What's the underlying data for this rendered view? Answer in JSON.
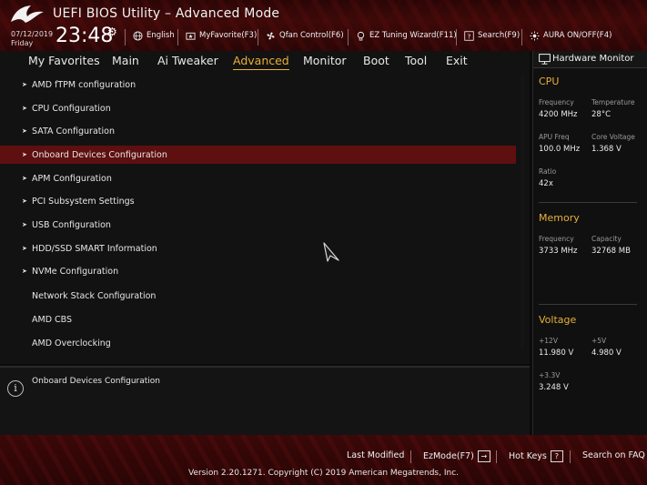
{
  "header": {
    "title": "UEFI BIOS Utility – Advanced Mode",
    "date": "07/12/2019",
    "weekday": "Friday",
    "time": "23:48",
    "buttons": [
      {
        "label": "English",
        "icon": "globe-icon"
      },
      {
        "label": "MyFavorite(F3)",
        "icon": "star-folder-icon"
      },
      {
        "label": "Qfan Control(F6)",
        "icon": "fan-icon"
      },
      {
        "label": "EZ Tuning Wizard(F11)",
        "icon": "lightbulb-icon"
      },
      {
        "label": "Search(F9)",
        "icon": "search-icon"
      },
      {
        "label": "AURA ON/OFF(F4)",
        "icon": "aura-icon"
      }
    ]
  },
  "nav": {
    "tabs": [
      {
        "label": "My Favorites",
        "active": false
      },
      {
        "label": "Main",
        "active": false
      },
      {
        "label": "Ai Tweaker",
        "active": false
      },
      {
        "label": "Advanced",
        "active": true
      },
      {
        "label": "Monitor",
        "active": false
      },
      {
        "label": "Boot",
        "active": false
      },
      {
        "label": "Tool",
        "active": false
      },
      {
        "label": "Exit",
        "active": false
      }
    ]
  },
  "menu": {
    "items": [
      {
        "label": "AMD fTPM configuration",
        "submenu": true
      },
      {
        "label": "CPU Configuration",
        "submenu": true
      },
      {
        "label": "SATA Configuration",
        "submenu": true
      },
      {
        "label": "Onboard Devices Configuration",
        "submenu": true,
        "selected": true
      },
      {
        "label": "APM Configuration",
        "submenu": true
      },
      {
        "label": "PCI Subsystem Settings",
        "submenu": true
      },
      {
        "label": "USB Configuration",
        "submenu": true
      },
      {
        "label": "HDD/SSD SMART Information",
        "submenu": true
      },
      {
        "label": "NVMe Configuration",
        "submenu": true
      },
      {
        "label": "Network Stack Configuration",
        "submenu": false
      },
      {
        "label": "AMD CBS",
        "submenu": false
      },
      {
        "label": "AMD Overclocking",
        "submenu": false
      }
    ],
    "arrow_glyph": "➤"
  },
  "help": {
    "text": "Onboard Devices Configuration",
    "icon_glyph": "i"
  },
  "hwmon": {
    "title": "Hardware Monitor",
    "cpu": {
      "title": "CPU",
      "frequency_label": "Frequency",
      "frequency": "4200 MHz",
      "temperature_label": "Temperature",
      "temperature": "28°C",
      "apu_label": "APU Freq",
      "apu": "100.0 MHz",
      "vcore_label": "Core Voltage",
      "vcore": "1.368 V",
      "ratio_label": "Ratio",
      "ratio": "42x"
    },
    "memory": {
      "title": "Memory",
      "frequency_label": "Frequency",
      "frequency": "3733 MHz",
      "capacity_label": "Capacity",
      "capacity": "32768 MB"
    },
    "voltage": {
      "title": "Voltage",
      "v12_label": "+12V",
      "v12": "11.980 V",
      "v5_label": "+5V",
      "v5": "4.980 V",
      "v33_label": "+3.3V",
      "v33": "3.248 V"
    }
  },
  "footer": {
    "last_modified": "Last Modified",
    "ezmode": "EzMode(F7)",
    "ezmode_icon": "→",
    "hotkeys": "Hot Keys",
    "hotkeys_icon": "?",
    "faq": "Search on FAQ",
    "copyright": "Version 2.20.1271. Copyright (C) 2019 American Megatrends, Inc."
  },
  "colors": {
    "accent": "#e8b03a",
    "selected_row": "#5e0f0f",
    "header_red": "#3d0909"
  }
}
